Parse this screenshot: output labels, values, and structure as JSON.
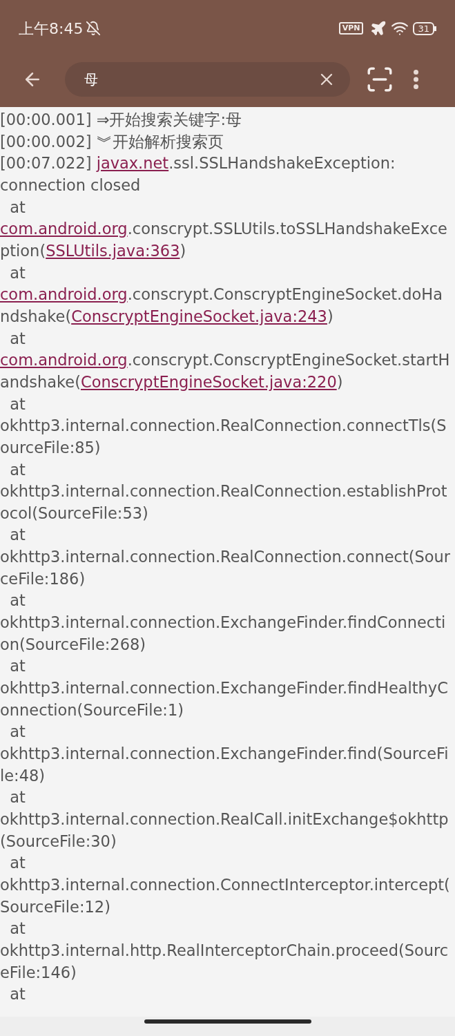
{
  "status_bar": {
    "time": "上午8:45",
    "vpn": "VPN",
    "battery": "31"
  },
  "search": {
    "value": "母"
  },
  "log_lines": [
    {
      "segments": [
        {
          "text": "[00:00.001] ⇒开始搜索关键字:母",
          "link": false
        }
      ]
    },
    {
      "segments": [
        {
          "text": "[00:00.002] ︾开始解析搜索页",
          "link": false
        }
      ]
    },
    {
      "segments": [
        {
          "text": "[00:07.022] ",
          "link": false
        },
        {
          "text": "javax.net",
          "link": true
        },
        {
          "text": ".ssl.SSLHandshakeException:",
          "link": false
        }
      ]
    },
    {
      "segments": [
        {
          "text": "connection closed",
          "link": false
        }
      ]
    },
    {
      "segments": [
        {
          "text": "  at",
          "link": false
        }
      ]
    },
    {
      "segments": [
        {
          "text": "com.android.org",
          "link": true
        },
        {
          "text": ".conscrypt.SSLUtils.toSSLHandshakeExce",
          "link": false
        }
      ]
    },
    {
      "segments": [
        {
          "text": "ption(",
          "link": false
        },
        {
          "text": "SSLUtils.java:363",
          "link": true
        },
        {
          "text": ")",
          "link": false
        }
      ]
    },
    {
      "segments": [
        {
          "text": "  at",
          "link": false
        }
      ]
    },
    {
      "segments": [
        {
          "text": "com.android.org",
          "link": true
        },
        {
          "text": ".conscrypt.ConscryptEngineSocket.doHa",
          "link": false
        }
      ]
    },
    {
      "segments": [
        {
          "text": "ndshake(",
          "link": false
        },
        {
          "text": "ConscryptEngineSocket.java:243",
          "link": true
        },
        {
          "text": ")",
          "link": false
        }
      ]
    },
    {
      "segments": [
        {
          "text": "  at",
          "link": false
        }
      ]
    },
    {
      "segments": [
        {
          "text": "com.android.org",
          "link": true
        },
        {
          "text": ".conscrypt.ConscryptEngineSocket.startH",
          "link": false
        }
      ]
    },
    {
      "segments": [
        {
          "text": "andshake(",
          "link": false
        },
        {
          "text": "ConscryptEngineSocket.java:220",
          "link": true
        },
        {
          "text": ")",
          "link": false
        }
      ]
    },
    {
      "segments": [
        {
          "text": "  at",
          "link": false
        }
      ]
    },
    {
      "segments": [
        {
          "text": "okhttp3.internal.connection.RealConnection.connectTls(S",
          "link": false
        }
      ]
    },
    {
      "segments": [
        {
          "text": "ourceFile:85)",
          "link": false
        }
      ]
    },
    {
      "segments": [
        {
          "text": "  at",
          "link": false
        }
      ]
    },
    {
      "segments": [
        {
          "text": "okhttp3.internal.connection.RealConnection.establishProt",
          "link": false
        }
      ]
    },
    {
      "segments": [
        {
          "text": "ocol(SourceFile:53)",
          "link": false
        }
      ]
    },
    {
      "segments": [
        {
          "text": "  at",
          "link": false
        }
      ]
    },
    {
      "segments": [
        {
          "text": "okhttp3.internal.connection.RealConnection.connect(Sour",
          "link": false
        }
      ]
    },
    {
      "segments": [
        {
          "text": "ceFile:186)",
          "link": false
        }
      ]
    },
    {
      "segments": [
        {
          "text": "  at",
          "link": false
        }
      ]
    },
    {
      "segments": [
        {
          "text": "okhttp3.internal.connection.ExchangeFinder.findConnecti",
          "link": false
        }
      ]
    },
    {
      "segments": [
        {
          "text": "on(SourceFile:268)",
          "link": false
        }
      ]
    },
    {
      "segments": [
        {
          "text": "  at",
          "link": false
        }
      ]
    },
    {
      "segments": [
        {
          "text": "okhttp3.internal.connection.ExchangeFinder.findHealthyC",
          "link": false
        }
      ]
    },
    {
      "segments": [
        {
          "text": "onnection(SourceFile:1)",
          "link": false
        }
      ]
    },
    {
      "segments": [
        {
          "text": "  at",
          "link": false
        }
      ]
    },
    {
      "segments": [
        {
          "text": "okhttp3.internal.connection.ExchangeFinder.find(SourceFi",
          "link": false
        }
      ]
    },
    {
      "segments": [
        {
          "text": "le:48)",
          "link": false
        }
      ]
    },
    {
      "segments": [
        {
          "text": "  at",
          "link": false
        }
      ]
    },
    {
      "segments": [
        {
          "text": "okhttp3.internal.connection.RealCall.initExchange$okhttp",
          "link": false
        }
      ]
    },
    {
      "segments": [
        {
          "text": "(SourceFile:30)",
          "link": false
        }
      ]
    },
    {
      "segments": [
        {
          "text": "  at",
          "link": false
        }
      ]
    },
    {
      "segments": [
        {
          "text": "okhttp3.internal.connection.ConnectInterceptor.intercept(",
          "link": false
        }
      ]
    },
    {
      "segments": [
        {
          "text": "SourceFile:12)",
          "link": false
        }
      ]
    },
    {
      "segments": [
        {
          "text": "  at",
          "link": false
        }
      ]
    },
    {
      "segments": [
        {
          "text": "okhttp3.internal.http.RealInterceptorChain.proceed(Sourc",
          "link": false
        }
      ]
    },
    {
      "segments": [
        {
          "text": "eFile:146)",
          "link": false
        }
      ]
    },
    {
      "segments": [
        {
          "text": "  at",
          "link": false
        }
      ]
    }
  ]
}
